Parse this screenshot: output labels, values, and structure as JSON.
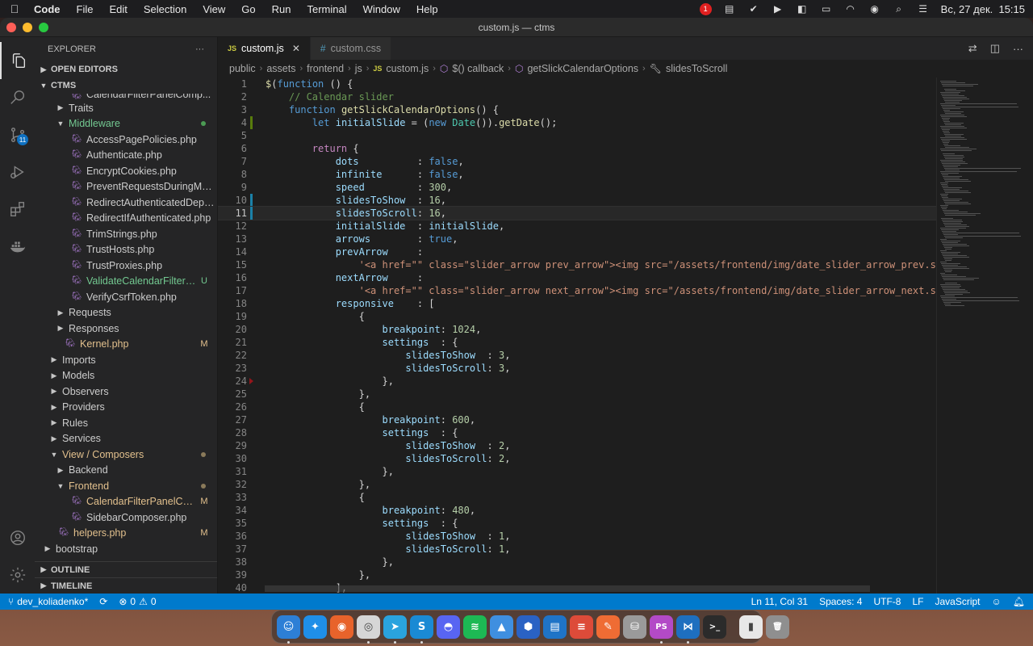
{
  "menubar": {
    "app_name": "Code",
    "menus": [
      "File",
      "Edit",
      "Selection",
      "View",
      "Go",
      "Run",
      "Terminal",
      "Window",
      "Help"
    ],
    "notification_count": "1",
    "clock": "Вс, 27 дек.  15:15"
  },
  "window": {
    "title": "custom.js — ctms"
  },
  "activity": {
    "scm_badge": "11"
  },
  "sidebar": {
    "explorer_title": "EXPLORER",
    "more_label": "···",
    "open_editors": "OPEN EDITORS",
    "project": "CTMS",
    "tree": [
      {
        "label": "CalendarFilterPanelComp...",
        "indent": 3,
        "type": "file",
        "partial": true
      },
      {
        "label": "Traits",
        "indent": 2,
        "type": "folder",
        "open": false
      },
      {
        "label": "Middleware",
        "indent": 2,
        "type": "folder",
        "open": true,
        "color": "green",
        "dot": "#4b9b53"
      },
      {
        "label": "AccessPagePolicies.php",
        "indent": 3,
        "type": "file"
      },
      {
        "label": "Authenticate.php",
        "indent": 3,
        "type": "file"
      },
      {
        "label": "EncryptCookies.php",
        "indent": 3,
        "type": "file"
      },
      {
        "label": "PreventRequestsDuringMainte...",
        "indent": 3,
        "type": "file"
      },
      {
        "label": "RedirectAuthenticatedDependi...",
        "indent": 3,
        "type": "file"
      },
      {
        "label": "RedirectIfAuthenticated.php",
        "indent": 3,
        "type": "file"
      },
      {
        "label": "TrimStrings.php",
        "indent": 3,
        "type": "file"
      },
      {
        "label": "TrustHosts.php",
        "indent": 3,
        "type": "file"
      },
      {
        "label": "TrustProxies.php",
        "indent": 3,
        "type": "file"
      },
      {
        "label": "ValidateCalendarFilterQu...",
        "indent": 3,
        "type": "file",
        "color": "green",
        "status": "U"
      },
      {
        "label": "VerifyCsrfToken.php",
        "indent": 3,
        "type": "file"
      },
      {
        "label": "Requests",
        "indent": 2,
        "type": "folder",
        "open": false
      },
      {
        "label": "Responses",
        "indent": 2,
        "type": "folder",
        "open": false
      },
      {
        "label": "Kernel.php",
        "indent": 2,
        "type": "file",
        "color": "orange",
        "status": "M"
      },
      {
        "label": "Imports",
        "indent": 1,
        "type": "folder",
        "open": false
      },
      {
        "label": "Models",
        "indent": 1,
        "type": "folder",
        "open": false
      },
      {
        "label": "Observers",
        "indent": 1,
        "type": "folder",
        "open": false
      },
      {
        "label": "Providers",
        "indent": 1,
        "type": "folder",
        "open": false
      },
      {
        "label": "Rules",
        "indent": 1,
        "type": "folder",
        "open": false
      },
      {
        "label": "Services",
        "indent": 1,
        "type": "folder",
        "open": false
      },
      {
        "label": "View / Composers",
        "indent": 1,
        "type": "folder",
        "open": true,
        "color": "orange",
        "dot": "#8a7a5a"
      },
      {
        "label": "Backend",
        "indent": 2,
        "type": "folder",
        "open": false
      },
      {
        "label": "Frontend",
        "indent": 2,
        "type": "folder",
        "open": true,
        "color": "orange",
        "dot": "#8a7a5a"
      },
      {
        "label": "CalendarFilterPanelComp...",
        "indent": 3,
        "type": "file",
        "color": "orange",
        "status": "M"
      },
      {
        "label": "SidebarComposer.php",
        "indent": 3,
        "type": "file"
      },
      {
        "label": "helpers.php",
        "indent": 1,
        "type": "file",
        "color": "orange",
        "status": "M"
      },
      {
        "label": "bootstrap",
        "indent": 0,
        "type": "folder",
        "open": false
      }
    ],
    "outline": "OUTLINE",
    "timeline": "TIMELINE"
  },
  "tabs": [
    {
      "label": "custom.js",
      "icon": "js",
      "active": true
    },
    {
      "label": "custom.css",
      "icon": "css",
      "active": false
    }
  ],
  "breadcrumb": [
    {
      "label": "public"
    },
    {
      "label": "assets"
    },
    {
      "label": "frontend"
    },
    {
      "label": "js"
    },
    {
      "label": "custom.js",
      "icon": "js"
    },
    {
      "label": "$() callback",
      "icon": "cube"
    },
    {
      "label": "getSlickCalendarOptions",
      "icon": "cube"
    },
    {
      "label": "slidesToScroll",
      "icon": "wrench"
    }
  ],
  "code": {
    "current_line": 11,
    "lines": [
      [
        [
          "fn",
          "$"
        ],
        [
          "txt",
          "("
        ],
        [
          "kw",
          "function"
        ],
        [
          "txt",
          " () {"
        ]
      ],
      [
        [
          "txt",
          "    "
        ],
        [
          "cmt",
          "// Calendar slider"
        ]
      ],
      [
        [
          "txt",
          "    "
        ],
        [
          "kw",
          "function"
        ],
        [
          "txt",
          " "
        ],
        [
          "fn",
          "getSlickCalendarOptions"
        ],
        [
          "txt",
          "() {"
        ]
      ],
      [
        [
          "txt",
          "        "
        ],
        [
          "kw",
          "let"
        ],
        [
          "txt",
          " "
        ],
        [
          "var",
          "initialSlide"
        ],
        [
          "txt",
          " = ("
        ],
        [
          "kw",
          "new"
        ],
        [
          "txt",
          " "
        ],
        [
          "cls",
          "Date"
        ],
        [
          "txt",
          "())."
        ],
        [
          "fn",
          "getDate"
        ],
        [
          "txt",
          "();"
        ]
      ],
      [
        [
          "txt",
          ""
        ]
      ],
      [
        [
          "txt",
          "        "
        ],
        [
          "kw2",
          "return"
        ],
        [
          "txt",
          " {"
        ]
      ],
      [
        [
          "txt",
          "            "
        ],
        [
          "var",
          "dots"
        ],
        [
          "txt",
          "          : "
        ],
        [
          "kw",
          "false"
        ],
        [
          "txt",
          ","
        ]
      ],
      [
        [
          "txt",
          "            "
        ],
        [
          "var",
          "infinite"
        ],
        [
          "txt",
          "      : "
        ],
        [
          "kw",
          "false"
        ],
        [
          "txt",
          ","
        ]
      ],
      [
        [
          "txt",
          "            "
        ],
        [
          "var",
          "speed"
        ],
        [
          "txt",
          "         : "
        ],
        [
          "num",
          "300"
        ],
        [
          "txt",
          ","
        ]
      ],
      [
        [
          "txt",
          "            "
        ],
        [
          "var",
          "slidesToShow"
        ],
        [
          "txt",
          "  : "
        ],
        [
          "num",
          "16"
        ],
        [
          "txt",
          ","
        ]
      ],
      [
        [
          "txt",
          "            "
        ],
        [
          "var",
          "slidesToScroll"
        ],
        [
          "txt",
          ": "
        ],
        [
          "num",
          "16"
        ],
        [
          "txt",
          ","
        ]
      ],
      [
        [
          "txt",
          "            "
        ],
        [
          "var",
          "initialSlide"
        ],
        [
          "txt",
          "  : "
        ],
        [
          "var",
          "initialSlide"
        ],
        [
          "txt",
          ","
        ]
      ],
      [
        [
          "txt",
          "            "
        ],
        [
          "var",
          "arrows"
        ],
        [
          "txt",
          "        : "
        ],
        [
          "kw",
          "true"
        ],
        [
          "txt",
          ","
        ]
      ],
      [
        [
          "txt",
          "            "
        ],
        [
          "var",
          "prevArrow"
        ],
        [
          "txt",
          "     :"
        ]
      ],
      [
        [
          "txt",
          "                "
        ],
        [
          "str",
          "'<a href=\"\" class=\"slider_arrow prev_arrow\"><img src=\"/assets/frontend/img/date_slider_arrow_prev.svg\" alt=\"Prev i"
        ]
      ],
      [
        [
          "txt",
          "            "
        ],
        [
          "var",
          "nextArrow"
        ],
        [
          "txt",
          "     :"
        ]
      ],
      [
        [
          "txt",
          "                "
        ],
        [
          "str",
          "'<a href=\"\" class=\"slider_arrow next_arrow\"><img src=\"/assets/frontend/img/date_slider_arrow_next.svg\" alt=\"Next i"
        ]
      ],
      [
        [
          "txt",
          "            "
        ],
        [
          "var",
          "responsive"
        ],
        [
          "txt",
          "    : ["
        ]
      ],
      [
        [
          "txt",
          "                {"
        ]
      ],
      [
        [
          "txt",
          "                    "
        ],
        [
          "var",
          "breakpoint"
        ],
        [
          "txt",
          ": "
        ],
        [
          "num",
          "1024"
        ],
        [
          "txt",
          ","
        ]
      ],
      [
        [
          "txt",
          "                    "
        ],
        [
          "var",
          "settings"
        ],
        [
          "txt",
          "  : {"
        ]
      ],
      [
        [
          "txt",
          "                        "
        ],
        [
          "var",
          "slidesToShow"
        ],
        [
          "txt",
          "  : "
        ],
        [
          "num",
          "3"
        ],
        [
          "txt",
          ","
        ]
      ],
      [
        [
          "txt",
          "                        "
        ],
        [
          "var",
          "slidesToScroll"
        ],
        [
          "txt",
          ": "
        ],
        [
          "num",
          "3"
        ],
        [
          "txt",
          ","
        ]
      ],
      [
        [
          "txt",
          "                    },"
        ]
      ],
      [
        [
          "txt",
          "                },"
        ]
      ],
      [
        [
          "txt",
          "                {"
        ]
      ],
      [
        [
          "txt",
          "                    "
        ],
        [
          "var",
          "breakpoint"
        ],
        [
          "txt",
          ": "
        ],
        [
          "num",
          "600"
        ],
        [
          "txt",
          ","
        ]
      ],
      [
        [
          "txt",
          "                    "
        ],
        [
          "var",
          "settings"
        ],
        [
          "txt",
          "  : {"
        ]
      ],
      [
        [
          "txt",
          "                        "
        ],
        [
          "var",
          "slidesToShow"
        ],
        [
          "txt",
          "  : "
        ],
        [
          "num",
          "2"
        ],
        [
          "txt",
          ","
        ]
      ],
      [
        [
          "txt",
          "                        "
        ],
        [
          "var",
          "slidesToScroll"
        ],
        [
          "txt",
          ": "
        ],
        [
          "num",
          "2"
        ],
        [
          "txt",
          ","
        ]
      ],
      [
        [
          "txt",
          "                    },"
        ]
      ],
      [
        [
          "txt",
          "                },"
        ]
      ],
      [
        [
          "txt",
          "                {"
        ]
      ],
      [
        [
          "txt",
          "                    "
        ],
        [
          "var",
          "breakpoint"
        ],
        [
          "txt",
          ": "
        ],
        [
          "num",
          "480"
        ],
        [
          "txt",
          ","
        ]
      ],
      [
        [
          "txt",
          "                    "
        ],
        [
          "var",
          "settings"
        ],
        [
          "txt",
          "  : {"
        ]
      ],
      [
        [
          "txt",
          "                        "
        ],
        [
          "var",
          "slidesToShow"
        ],
        [
          "txt",
          "  : "
        ],
        [
          "num",
          "1"
        ],
        [
          "txt",
          ","
        ]
      ],
      [
        [
          "txt",
          "                        "
        ],
        [
          "var",
          "slidesToScroll"
        ],
        [
          "txt",
          ": "
        ],
        [
          "num",
          "1"
        ],
        [
          "txt",
          ","
        ]
      ],
      [
        [
          "txt",
          "                    },"
        ]
      ],
      [
        [
          "txt",
          "                },"
        ]
      ],
      [
        [
          "txt",
          "            ],"
        ]
      ]
    ],
    "gutter_marks": {
      "4": "add",
      "10": "mod",
      "11": "mod",
      "24": "del"
    }
  },
  "statusbar": {
    "branch": "dev_koliadenko*",
    "sync": "⟳",
    "errors": "0",
    "warnings": "0",
    "position": "Ln 11, Col 31",
    "spaces": "Spaces: 4",
    "encoding": "UTF-8",
    "eol": "LF",
    "language": "JavaScript"
  },
  "dock": {
    "apps": [
      {
        "name": "finder-icon",
        "bg": "#2d7fd6",
        "glyph": "☺",
        "running": true
      },
      {
        "name": "safari-icon",
        "bg": "#1f8fe8",
        "glyph": "✦",
        "running": false
      },
      {
        "name": "firefox-icon",
        "bg": "#e8632b",
        "glyph": "◉",
        "running": false
      },
      {
        "name": "chrome-icon",
        "bg": "#d6d6d6",
        "glyph": "◎",
        "running": true
      },
      {
        "name": "telegram-icon",
        "bg": "#2aa3de",
        "glyph": "➤",
        "running": true
      },
      {
        "name": "skype-icon",
        "bg": "#1a8ad4",
        "glyph": "S",
        "running": true
      },
      {
        "name": "discord-icon",
        "bg": "#5865f2",
        "glyph": "◓",
        "running": false
      },
      {
        "name": "spotify-icon",
        "bg": "#1db954",
        "glyph": "≋",
        "running": false
      },
      {
        "name": "testflight-icon",
        "bg": "#3f8fe0",
        "glyph": "▲",
        "running": false
      },
      {
        "name": "sourcetree-icon",
        "bg": "#2a62c4",
        "glyph": "⬢",
        "running": false
      },
      {
        "name": "trello-icon",
        "bg": "#1f74c7",
        "glyph": "▤",
        "running": false
      },
      {
        "name": "todoist-icon",
        "bg": "#dd4b39",
        "glyph": "≡",
        "running": false
      },
      {
        "name": "postman-icon",
        "bg": "#ef6c34",
        "glyph": "✎",
        "running": false
      },
      {
        "name": "sequel-icon",
        "bg": "#9a9a9a",
        "glyph": "⛁",
        "running": false
      },
      {
        "name": "phpstorm-icon",
        "bg": "#b34ac7",
        "glyph": "PS",
        "running": true
      },
      {
        "name": "vscode-icon",
        "bg": "#1e6fbf",
        "glyph": "⋈",
        "running": true
      },
      {
        "name": "terminal-icon",
        "bg": "#2b2b2b",
        "glyph": ">_",
        "running": false
      },
      {
        "name": "document-icon",
        "bg": "#e8e8e8",
        "glyph": "▮",
        "running": false
      },
      {
        "name": "trash-icon",
        "bg": "#8f8f8f",
        "glyph": "🗑",
        "running": false
      }
    ]
  },
  "colors": {
    "accent": "#007acc",
    "editor_bg": "#1e1e1e",
    "sidebar_bg": "#252526"
  }
}
